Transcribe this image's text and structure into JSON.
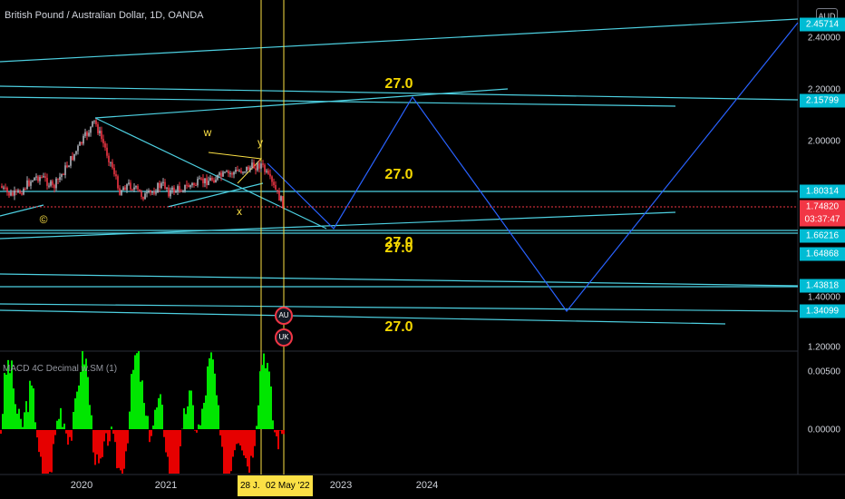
{
  "header": {
    "symbol_title": "British Pound / Australian Dollar, 1D, OANDA",
    "currency": "AUD"
  },
  "indicator": {
    "title": "MACD 4C Decimal w.SM (1)"
  },
  "price_axis": {
    "ticks": [
      "2.40000",
      "2.20000",
      "2.00000",
      "1.40000",
      "1.20000"
    ],
    "macd_ticks": [
      "0.00500",
      "0.00000"
    ],
    "tags": [
      {
        "value": "2.45714",
        "style": "cyan"
      },
      {
        "value": "2.15799",
        "style": "cyan"
      },
      {
        "value": "1.80314",
        "style": "cyan"
      },
      {
        "value": "1.74820",
        "style": "red"
      },
      {
        "value": "03:37:47",
        "style": "red"
      },
      {
        "value": "1.66216",
        "style": "cyan"
      },
      {
        "value": "1.64868",
        "style": "cyan"
      },
      {
        "value": "1.43818",
        "style": "cyan"
      },
      {
        "value": "1.34099",
        "style": "cyan"
      }
    ]
  },
  "time_axis": {
    "labels": [
      "2020",
      "2021",
      "2023",
      "2024"
    ],
    "highlight_start": "28 J.",
    "highlight_end": "02 May '22"
  },
  "annotations": [
    "27.0",
    "27.0",
    "27.0",
    "27.0",
    "27.0"
  ],
  "wave_labels": [
    "w",
    "y",
    "x",
    "©"
  ],
  "events": [
    {
      "name": "au-flag-icon",
      "text": "AU"
    },
    {
      "name": "uk-flag-icon",
      "text": "UK"
    }
  ],
  "colors": {
    "trendline": "#4dd0e1",
    "projection": "#2962ff",
    "candle_up": "#b2b5be",
    "candle_down": "#f23645",
    "macd_up": "#00e600",
    "macd_down": "#e60000",
    "highlight": "#fbe045",
    "annotation": "#f5d800"
  }
}
